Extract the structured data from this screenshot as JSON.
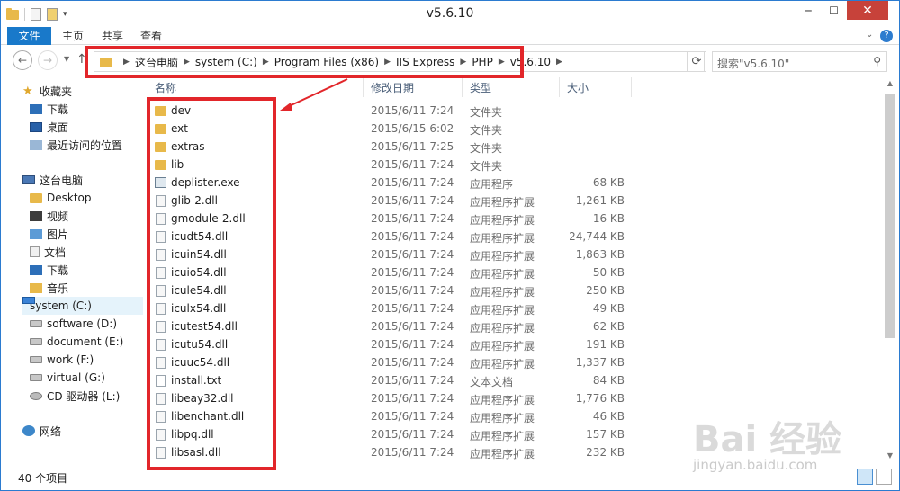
{
  "window": {
    "title": "v5.6.10",
    "min": "─",
    "max": "☐",
    "close": "✕"
  },
  "ribbon": {
    "file": "文件",
    "home": "主页",
    "share": "共享",
    "view": "查看",
    "expand": "⌄",
    "help": "?"
  },
  "address": {
    "crumbs": [
      "这台电脑",
      "system (C:)",
      "Program Files (x86)",
      "IIS Express",
      "PHP",
      "v5.6.10"
    ]
  },
  "search": {
    "placeholder": "搜索\"v5.6.10\""
  },
  "sidebar": {
    "favorites": {
      "label": "收藏夹",
      "items": [
        "下载",
        "桌面",
        "最近访问的位置"
      ]
    },
    "thispc": {
      "label": "这台电脑",
      "items": [
        "Desktop",
        "视频",
        "图片",
        "文档",
        "下载",
        "音乐",
        "system (C:)",
        "software (D:)",
        "document (E:)",
        "work (F:)",
        "virtual (G:)",
        "CD 驱动器 (L:)"
      ]
    },
    "network": {
      "label": "网络"
    }
  },
  "columns": {
    "name": "名称",
    "date": "修改日期",
    "type": "类型",
    "size": "大小"
  },
  "files": [
    {
      "name": "dev",
      "date": "2015/6/11 7:24",
      "type": "文件夹",
      "size": "",
      "icon": "dir"
    },
    {
      "name": "ext",
      "date": "2015/6/15 6:02",
      "type": "文件夹",
      "size": "",
      "icon": "dir"
    },
    {
      "name": "extras",
      "date": "2015/6/11 7:25",
      "type": "文件夹",
      "size": "",
      "icon": "dir"
    },
    {
      "name": "lib",
      "date": "2015/6/11 7:24",
      "type": "文件夹",
      "size": "",
      "icon": "dir"
    },
    {
      "name": "deplister.exe",
      "date": "2015/6/11 7:24",
      "type": "应用程序",
      "size": "68 KB",
      "icon": "exe"
    },
    {
      "name": "glib-2.dll",
      "date": "2015/6/11 7:24",
      "type": "应用程序扩展",
      "size": "1,261 KB",
      "icon": "dll"
    },
    {
      "name": "gmodule-2.dll",
      "date": "2015/6/11 7:24",
      "type": "应用程序扩展",
      "size": "16 KB",
      "icon": "dll"
    },
    {
      "name": "icudt54.dll",
      "date": "2015/6/11 7:24",
      "type": "应用程序扩展",
      "size": "24,744 KB",
      "icon": "dll"
    },
    {
      "name": "icuin54.dll",
      "date": "2015/6/11 7:24",
      "type": "应用程序扩展",
      "size": "1,863 KB",
      "icon": "dll"
    },
    {
      "name": "icuio54.dll",
      "date": "2015/6/11 7:24",
      "type": "应用程序扩展",
      "size": "50 KB",
      "icon": "dll"
    },
    {
      "name": "icule54.dll",
      "date": "2015/6/11 7:24",
      "type": "应用程序扩展",
      "size": "250 KB",
      "icon": "dll"
    },
    {
      "name": "iculx54.dll",
      "date": "2015/6/11 7:24",
      "type": "应用程序扩展",
      "size": "49 KB",
      "icon": "dll"
    },
    {
      "name": "icutest54.dll",
      "date": "2015/6/11 7:24",
      "type": "应用程序扩展",
      "size": "62 KB",
      "icon": "dll"
    },
    {
      "name": "icutu54.dll",
      "date": "2015/6/11 7:24",
      "type": "应用程序扩展",
      "size": "191 KB",
      "icon": "dll"
    },
    {
      "name": "icuuc54.dll",
      "date": "2015/6/11 7:24",
      "type": "应用程序扩展",
      "size": "1,337 KB",
      "icon": "dll"
    },
    {
      "name": "install.txt",
      "date": "2015/6/11 7:24",
      "type": "文本文档",
      "size": "84 KB",
      "icon": "txt"
    },
    {
      "name": "libeay32.dll",
      "date": "2015/6/11 7:24",
      "type": "应用程序扩展",
      "size": "1,776 KB",
      "icon": "dll"
    },
    {
      "name": "libenchant.dll",
      "date": "2015/6/11 7:24",
      "type": "应用程序扩展",
      "size": "46 KB",
      "icon": "dll"
    },
    {
      "name": "libpq.dll",
      "date": "2015/6/11 7:24",
      "type": "应用程序扩展",
      "size": "157 KB",
      "icon": "dll"
    },
    {
      "name": "libsasl.dll",
      "date": "2015/6/11 7:24",
      "type": "应用程序扩展",
      "size": "232 KB",
      "icon": "dll"
    }
  ],
  "status": {
    "count": "40 个项目"
  },
  "watermark": {
    "logo": "Bai 经验",
    "url": "jingyan.baidu.com"
  },
  "colors": {
    "accent": "#1979ca",
    "highlight": "#e2262a",
    "close": "#c7423a",
    "selected": "#e5f3fb"
  }
}
